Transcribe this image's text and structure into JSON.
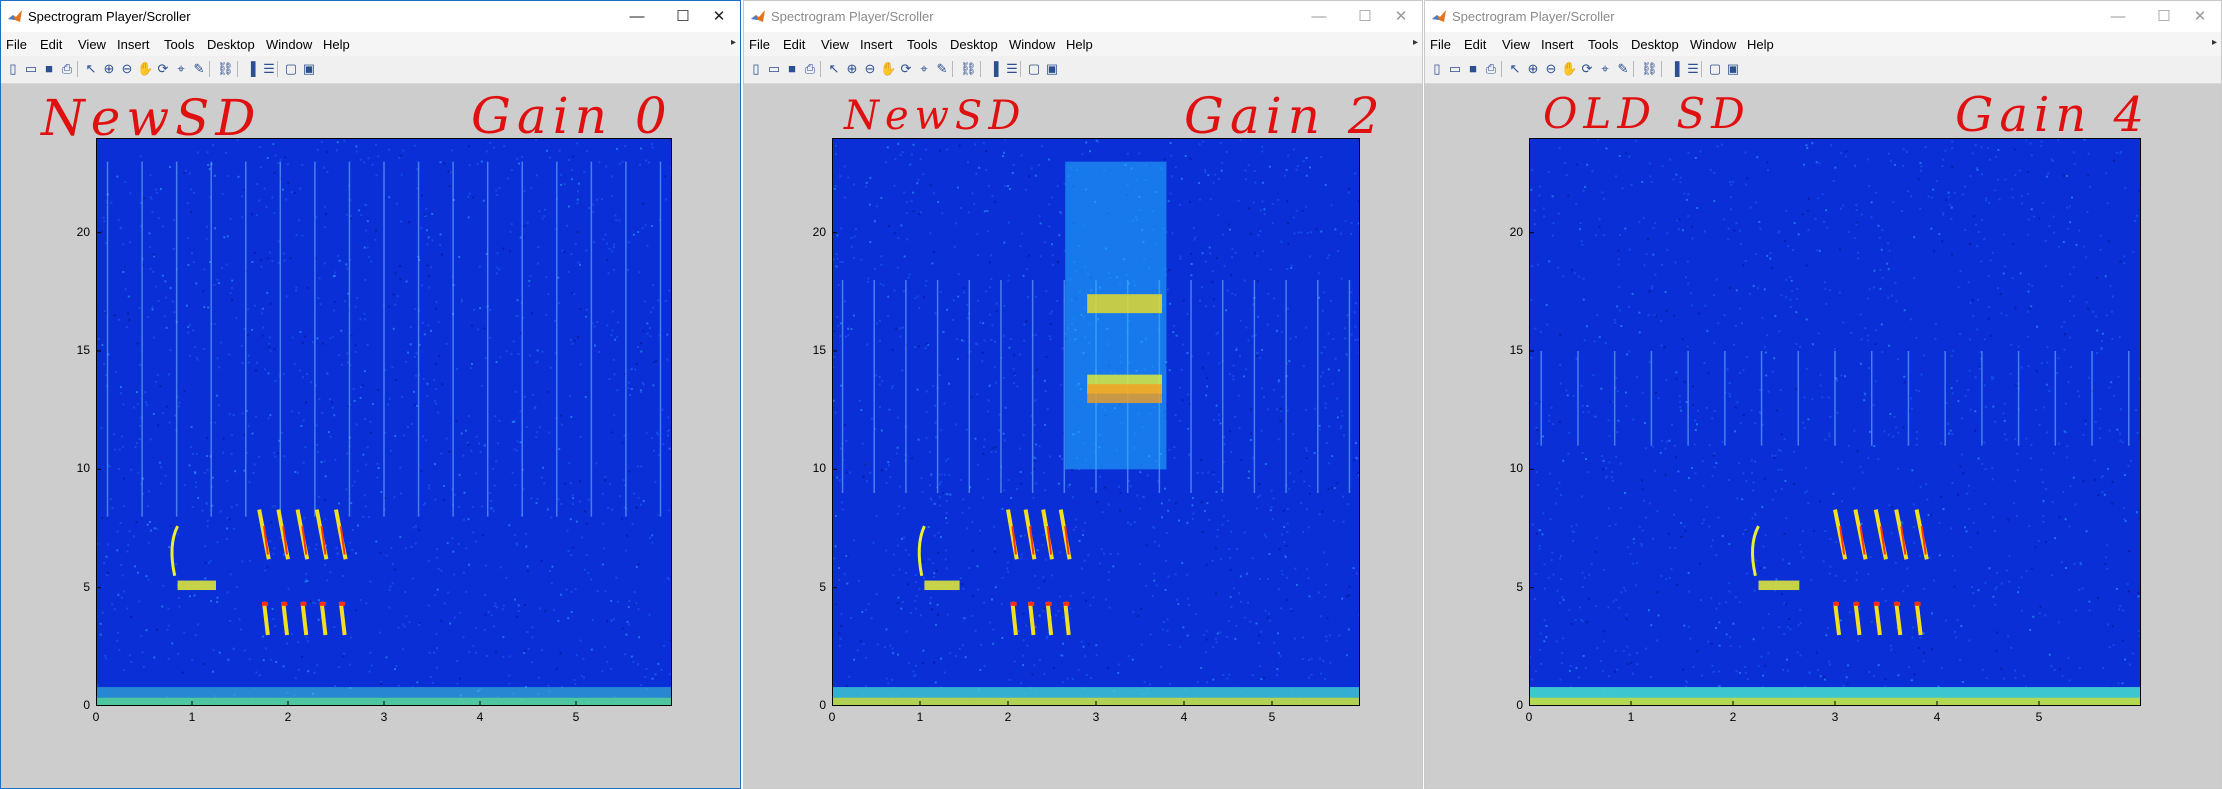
{
  "app": {
    "window_title": "Spectrogram Player/Scroller",
    "window_controls": {
      "minimize": "—",
      "maximize": "☐",
      "close": "✕"
    },
    "menus": [
      "File",
      "Edit",
      "View",
      "Insert",
      "Tools",
      "Desktop",
      "Window",
      "Help"
    ],
    "toolbar_icons": [
      "new-file-icon",
      "open-folder-icon",
      "save-icon",
      "print-icon",
      "pointer-icon",
      "zoom-in-icon",
      "zoom-out-icon",
      "pan-hand-icon",
      "rotate-icon",
      "data-cursor-icon",
      "brush-icon",
      "link-icon",
      "colorbar-icon",
      "legend-icon",
      "hide-axes-icon",
      "show-tools-icon"
    ]
  },
  "colors": {
    "spectrogram_background": "#0a2fd6",
    "annotation": "#e01010",
    "figure_background": "#cdcdcd",
    "active_border": "#1e6fc2"
  },
  "windows": [
    {
      "state": "active",
      "annotation_left": "NewSD",
      "annotation_right": "Gain 0",
      "chart_data": {
        "type": "heatmap",
        "title": "",
        "xlabel": "",
        "ylabel": "",
        "x_ticks": [
          "0",
          "1",
          "2",
          "3",
          "4",
          "5"
        ],
        "y_ticks": [
          "0",
          "5",
          "10",
          "15",
          "20"
        ],
        "xlim": [
          0,
          6
        ],
        "ylim": [
          0,
          24
        ],
        "colormap": "jet"
      }
    },
    {
      "state": "inactive",
      "annotation_left": "NewSD",
      "annotation_right": "Gain 2",
      "chart_data": {
        "type": "heatmap",
        "title": "",
        "xlabel": "",
        "ylabel": "",
        "x_ticks": [
          "0",
          "1",
          "2",
          "3",
          "4",
          "5"
        ],
        "y_ticks": [
          "0",
          "5",
          "10",
          "15",
          "20"
        ],
        "xlim": [
          0,
          6
        ],
        "ylim": [
          0,
          24
        ],
        "colormap": "jet"
      }
    },
    {
      "state": "inactive",
      "annotation_left": "OLD SD",
      "annotation_right": "Gain 4",
      "chart_data": {
        "type": "heatmap",
        "title": "",
        "xlabel": "",
        "ylabel": "",
        "x_ticks": [
          "0",
          "1",
          "2",
          "3",
          "4",
          "5"
        ],
        "y_ticks": [
          "0",
          "5",
          "10",
          "15",
          "20"
        ],
        "xlim": [
          0,
          6
        ],
        "ylim": [
          0,
          24
        ],
        "colormap": "jet"
      }
    }
  ]
}
